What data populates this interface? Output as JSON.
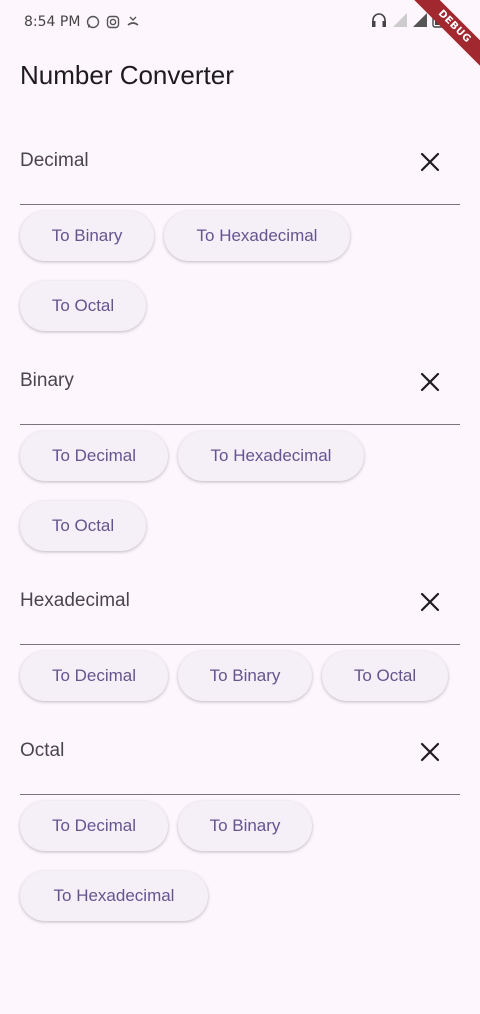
{
  "status_bar": {
    "time": "8:54 PM",
    "left_icons": [
      "whatsapp-icon",
      "instagram-icon",
      "missed-call-icon"
    ],
    "right_icons": [
      "headphones-icon",
      "signal-icon",
      "signal-icon",
      "battery-icon"
    ]
  },
  "debug_banner": "DEBUG",
  "app_bar": {
    "title": "Number Converter"
  },
  "sections": [
    {
      "label": "Decimal",
      "buttons": [
        "To Binary",
        "To Hexadecimal",
        "To Octal"
      ]
    },
    {
      "label": "Binary",
      "buttons": [
        "To Decimal",
        "To Hexadecimal",
        "To Octal"
      ]
    },
    {
      "label": "Hexadecimal",
      "buttons": [
        "To Decimal",
        "To Binary",
        "To Octal"
      ]
    },
    {
      "label": "Octal",
      "buttons": [
        "To Decimal",
        "To Binary",
        "To Hexadecimal"
      ]
    }
  ],
  "colors": {
    "background": "#fdf7fd",
    "button_bg": "#f5eff7",
    "button_text": "#65558f",
    "label_text": "#49454f",
    "debug_ribbon": "#a0282e"
  }
}
